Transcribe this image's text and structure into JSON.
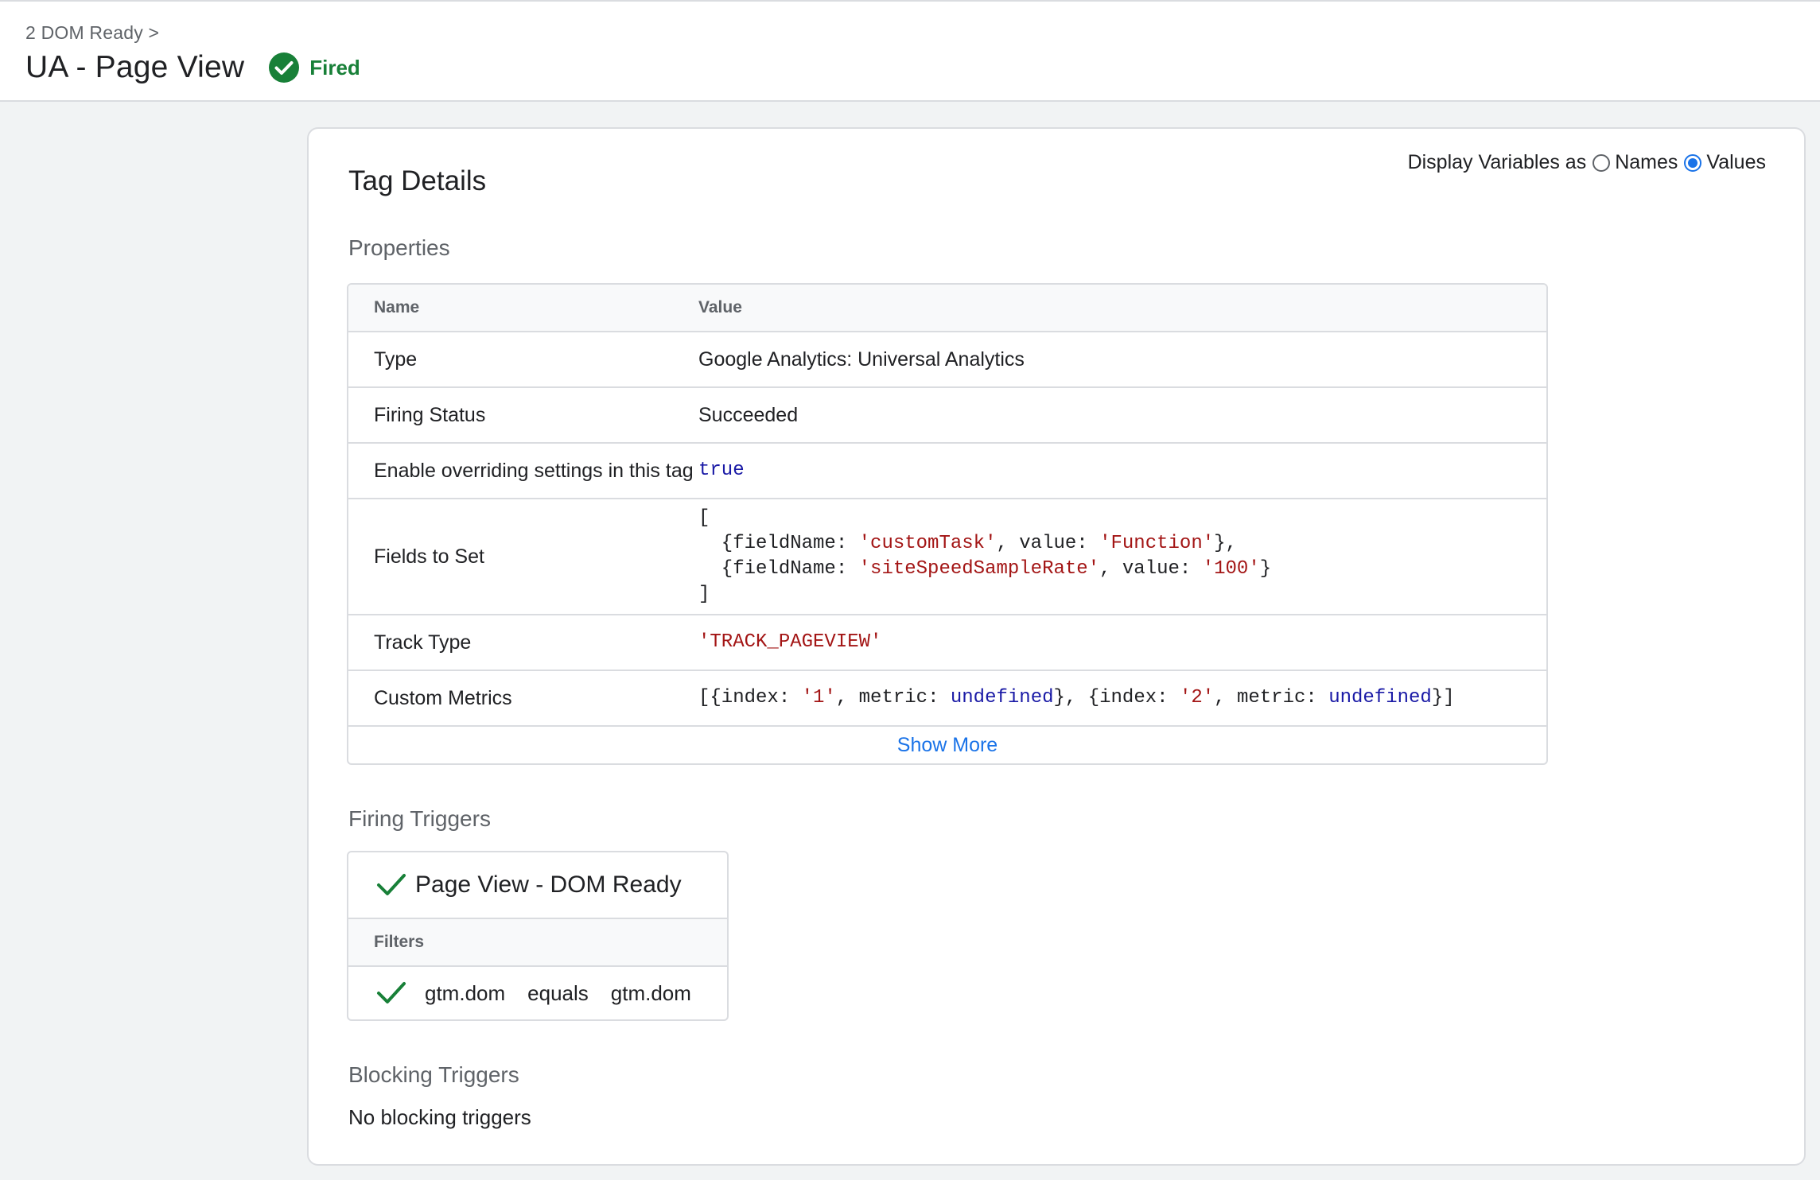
{
  "header": {
    "breadcrumb": "2 DOM Ready >",
    "title": "UA - Page View",
    "status_label": "Fired",
    "status_icon": "check-circle-icon",
    "status_color": "#188038"
  },
  "tag_details": {
    "title": "Tag Details",
    "display_vars": {
      "label": "Display Variables as",
      "options": [
        {
          "label": "Names",
          "selected": false
        },
        {
          "label": "Values",
          "selected": true
        }
      ]
    },
    "properties": {
      "section_title": "Properties",
      "columns": [
        "Name",
        "Value"
      ],
      "rows": [
        {
          "name": "Type",
          "value": "Google Analytics: Universal Analytics"
        },
        {
          "name": "Firing Status",
          "value": "Succeeded"
        },
        {
          "name": "Enable overriding settings in this tag",
          "value": "true"
        },
        {
          "name": "Fields to Set",
          "value": "[\n  {fieldName: 'customTask', value: 'Function'},\n  {fieldName: 'siteSpeedSampleRate', value: '100'}\n]"
        },
        {
          "name": "Track Type",
          "value": "'TRACK_PAGEVIEW'"
        },
        {
          "name": "Custom Metrics",
          "value": "[{index: '1', metric: undefined}, {index: '2', metric: undefined}]"
        }
      ],
      "show_more_label": "Show More"
    },
    "firing_triggers": {
      "section_title": "Firing Triggers",
      "trigger": {
        "name": "Page View - DOM Ready",
        "icon": "check-icon",
        "filters_label": "Filters",
        "filters": [
          {
            "variable": "gtm.dom",
            "operator": "equals",
            "value": "gtm.dom",
            "icon": "check-icon"
          }
        ]
      }
    },
    "blocking_triggers": {
      "section_title": "Blocking Triggers",
      "empty_text": "No blocking triggers"
    }
  }
}
